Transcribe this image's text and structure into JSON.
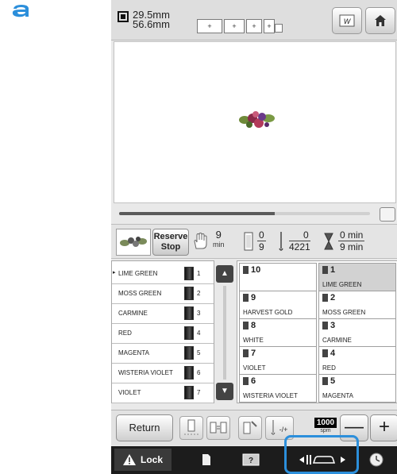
{
  "callout": {
    "letter": "a"
  },
  "header": {
    "size_icon": "embroidery-size-icon",
    "width": "29.5mm",
    "height": "56.6mm",
    "frame_labels": [
      "+",
      "+",
      "+",
      "+"
    ],
    "mirror_icon": "mirror-w-icon",
    "home_icon": "home-icon"
  },
  "preview": {
    "design_icon": "flower-design-icon"
  },
  "progress": {
    "fraction": 0.62
  },
  "status": {
    "thumbnail_icon": "flower-thumbnail-icon",
    "reserve_label_1": "Reserve",
    "reserve_label_2": "Stop",
    "time_value": "9",
    "time_unit": "min",
    "color_top": "0",
    "color_bottom": "9",
    "stitch_top": "0",
    "stitch_bottom": "4221",
    "time_top": "0 min",
    "time_bottom": "9 min"
  },
  "thread_list": [
    {
      "name": "LIME GREEN",
      "num": "1",
      "active": true
    },
    {
      "name": "MOSS GREEN",
      "num": "2"
    },
    {
      "name": "CARMINE",
      "num": "3"
    },
    {
      "name": "RED",
      "num": "4"
    },
    {
      "name": "MAGENTA",
      "num": "5"
    },
    {
      "name": "WISTERIA VIOLET",
      "num": "6"
    },
    {
      "name": "VIOLET",
      "num": "7"
    }
  ],
  "grid": {
    "left": [
      {
        "num": "10",
        "name": ""
      },
      {
        "num": "9",
        "name": "HARVEST GOLD"
      },
      {
        "num": "8",
        "name": "WHITE"
      },
      {
        "num": "7",
        "name": "VIOLET"
      },
      {
        "num": "6",
        "name": "WISTERIA VIOLET"
      }
    ],
    "right": [
      {
        "num": "1",
        "name": "LIME GREEN",
        "selected": true
      },
      {
        "num": "2",
        "name": "MOSS GREEN"
      },
      {
        "num": "3",
        "name": "CARMINE"
      },
      {
        "num": "4",
        "name": "RED"
      },
      {
        "num": "5",
        "name": "MAGENTA"
      }
    ]
  },
  "toolbar": {
    "return_label": "Return",
    "speed_value": "1000",
    "speed_unit": "spm",
    "minus_label": "—",
    "plus_label": "+"
  },
  "bottom": {
    "lock_label": "Lock"
  },
  "colors": {
    "highlight": "#2c8fdb",
    "bottom_bar": "#1c1c1c"
  }
}
